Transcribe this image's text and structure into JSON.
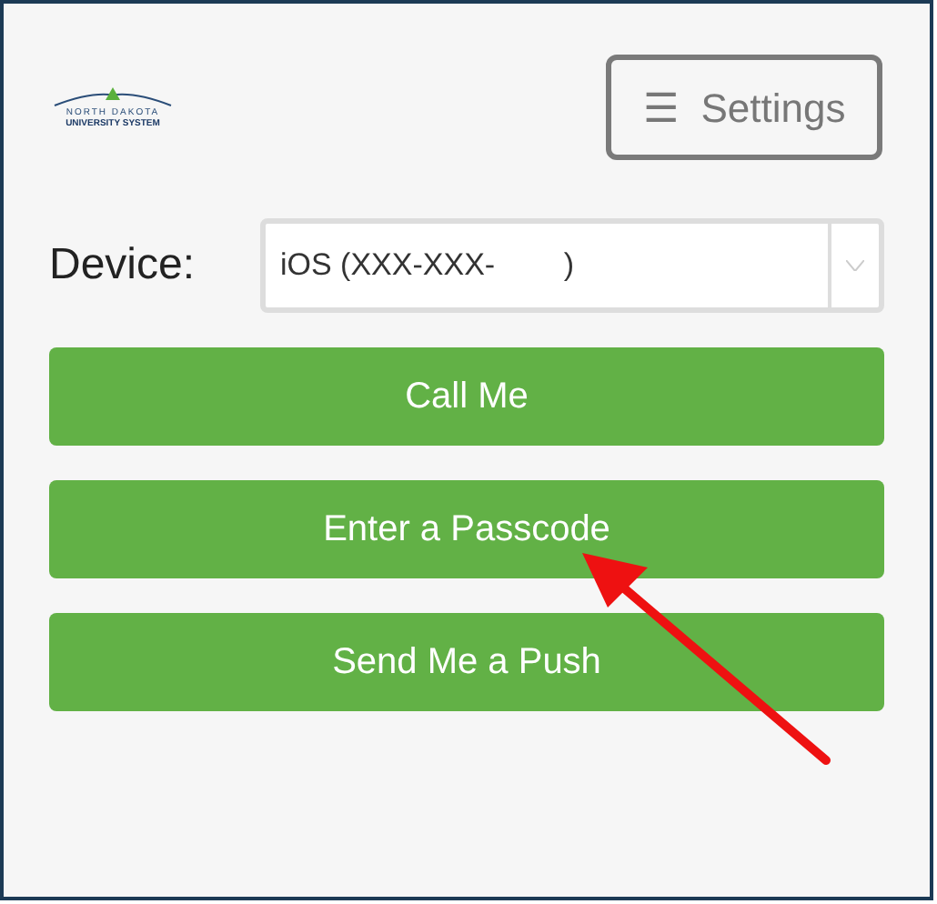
{
  "logo": {
    "line_1": "NORTH DAKOTA",
    "line_2": "UNIVERSITY SYSTEM"
  },
  "settings_button": {
    "icon": "☰",
    "label": "Settings"
  },
  "device": {
    "label": "Device:",
    "value": "iOS (XXX-XXX-        )"
  },
  "buttons": [
    "Call Me",
    "Enter a Passcode",
    "Send Me a Push"
  ]
}
